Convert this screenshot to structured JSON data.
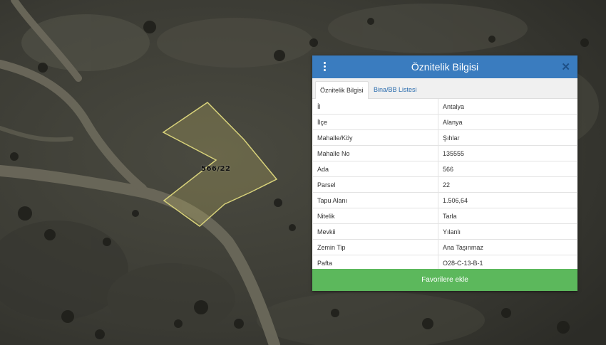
{
  "map": {
    "parcel_label": "566/22"
  },
  "panel": {
    "title": "Öznitelik Bilgisi",
    "close_symbol": "✕",
    "tabs": [
      {
        "label": "Öznitelik Bilgisi",
        "active": true
      },
      {
        "label": "Bina/BB Listesi",
        "active": false
      }
    ],
    "rows": [
      {
        "key": "İl",
        "value": "Antalya"
      },
      {
        "key": "İlçe",
        "value": "Alanya"
      },
      {
        "key": "Mahalle/Köy",
        "value": "Şıhlar"
      },
      {
        "key": "Mahalle No",
        "value": "135555"
      },
      {
        "key": "Ada",
        "value": "566"
      },
      {
        "key": "Parsel",
        "value": "22"
      },
      {
        "key": "Tapu Alanı",
        "value": "1.506,64"
      },
      {
        "key": "Nitelik",
        "value": "Tarla"
      },
      {
        "key": "Mevkii",
        "value": "Yılanlı"
      },
      {
        "key": "Zemin Tip",
        "value": "Ana Taşınmaz"
      },
      {
        "key": "Pafta",
        "value": "O28-C-13-B-1"
      }
    ],
    "favorite_button": "Favorilere ekle"
  },
  "colors": {
    "header_blue": "#3a7cbf",
    "button_green": "#5cb85c",
    "parcel_outline": "#d8d27a",
    "tab_link": "#2a6cae"
  },
  "icons": {
    "menu": "vertical-ellipsis-icon",
    "close": "close-icon"
  }
}
